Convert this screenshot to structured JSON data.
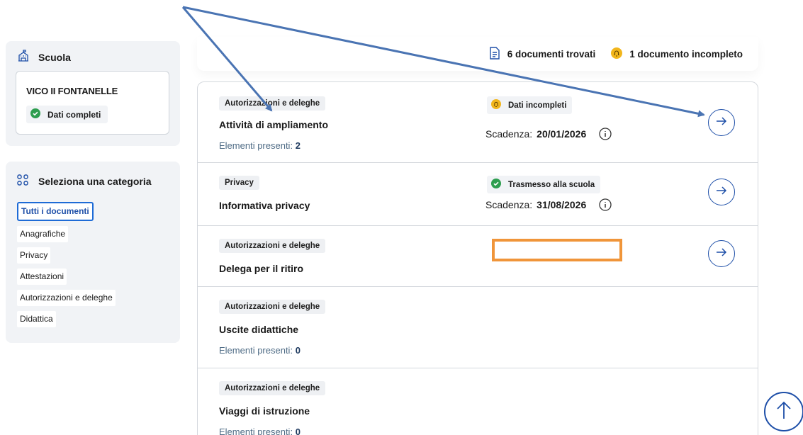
{
  "school": {
    "heading": "Scuola",
    "name": "VICO II FONTANELLE",
    "status": "Dati completi"
  },
  "categories": {
    "heading": "Seleziona una categoria",
    "items": [
      "Tutti i documenti",
      "Anagrafiche",
      "Privacy",
      "Attestazioni",
      "Autorizzazioni e deleghe",
      "Didattica"
    ],
    "selected": "Tutti i documenti"
  },
  "summary": {
    "found": "6 documenti trovati",
    "incomplete": "1 documento incompleto"
  },
  "documents": [
    {
      "tag": "Autorizzazioni e deleghe",
      "title": "Attività di ampliamento",
      "elements_label": "Elementi presenti:",
      "elements_count": "2",
      "status": "Dati incompleti",
      "deadline_label": "Scadenza:",
      "deadline": "20/01/2026"
    },
    {
      "tag": "Privacy",
      "title": "Informativa privacy",
      "status": "Trasmesso alla scuola",
      "deadline_label": "Scadenza:",
      "deadline": "31/08/2026"
    },
    {
      "tag": "Autorizzazioni e deleghe",
      "title": "Delega per il ritiro"
    },
    {
      "tag": "Autorizzazioni e deleghe",
      "title": "Uscite didattiche",
      "elements_label": "Elementi presenti:",
      "elements_count": "0"
    },
    {
      "tag": "Autorizzazioni e deleghe",
      "title": "Viaggi di istruzione",
      "elements_label": "Elementi presenti:",
      "elements_count": "0"
    }
  ],
  "colors": {
    "accent": "#1e4fa8",
    "complete": "#2e9e4f",
    "warning": "#f2b61c",
    "highlight_box": "#f0953a",
    "annotation_arrow": "#4a74b3"
  },
  "icons": {
    "school": "school-building-icon",
    "categories": "grid-icon",
    "found": "document-icon",
    "incomplete": "bell-icon",
    "go": "arrow-right-circle-icon",
    "info": "info-icon",
    "scroll_top": "arrow-up-icon"
  }
}
